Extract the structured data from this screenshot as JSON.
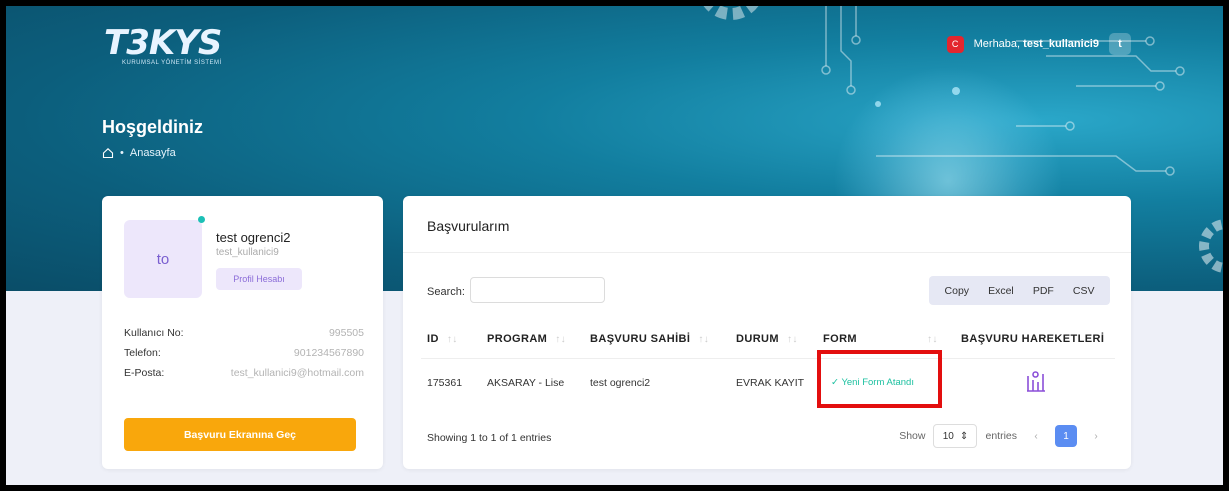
{
  "header": {
    "logo_text": "T3KYS",
    "logo_subtitle": "KURUMSAL YÖNETİM SİSTEMİ",
    "greeting_prefix": "Merhaba,",
    "username": "test_kullanici9",
    "avatar_letter": "t",
    "flag": "C"
  },
  "page": {
    "title": "Hoşgeldiniz",
    "breadcrumb_sep": "•",
    "breadcrumb": "Anasayfa"
  },
  "profile": {
    "avatar_initials": "to",
    "name": "test ogrenci2",
    "username": "test_kullanici9",
    "profile_button": "Profil Hesabı",
    "fields": [
      {
        "label": "Kullanıcı No:",
        "value": "995505"
      },
      {
        "label": "Telefon:",
        "value": "901234567890"
      },
      {
        "label": "E-Posta:",
        "value": "test_kullanici9@hotmail.com"
      }
    ],
    "action_button": "Başvuru Ekranına Geç"
  },
  "applications": {
    "title": "Başvurularım",
    "search_label": "Search:",
    "search_value": "",
    "export_buttons": [
      "Copy",
      "Excel",
      "PDF",
      "CSV"
    ],
    "columns": [
      "ID",
      "PROGRAM",
      "BAŞVURU SAHİBİ",
      "DURUM",
      "FORM",
      "BAŞVURU HAREKETLERİ"
    ],
    "rows": [
      {
        "id": "175361",
        "program": "AKSARAY - Lise",
        "owner": "test ogrenci2",
        "status": "EVRAK KAYIT",
        "form": "Yeni Form Atandı"
      }
    ],
    "showing": "Showing 1 to 1 of 1 entries",
    "show_label": "Show",
    "page_size": "10",
    "entries_label": "entries",
    "current_page": "1",
    "prev": "‹",
    "next": "›"
  }
}
